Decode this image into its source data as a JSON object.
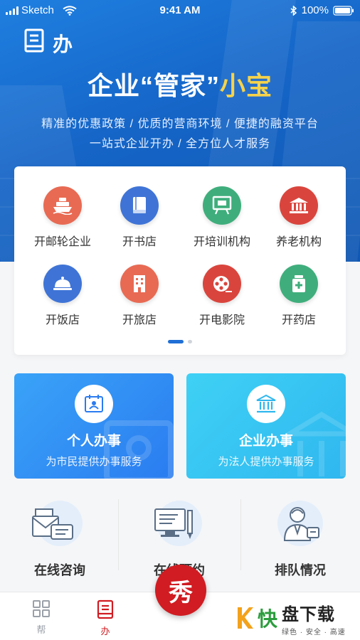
{
  "status_bar": {
    "carrier": "Sketch",
    "time": "9:41 AM",
    "battery": "100%"
  },
  "brand": {
    "title": "办"
  },
  "hero": {
    "headline_main": "企业“管家”",
    "headline_accent": "小宝",
    "subline1": "精准的优惠政策 / 优质的营商环境 / 便捷的融资平台",
    "subline2": "一站式企业开办 / 全方位人才服务"
  },
  "grid": {
    "items": [
      {
        "label": "开邮轮企业",
        "icon": "cruise-ship-icon",
        "color": "#e86a53"
      },
      {
        "label": "开书店",
        "icon": "book-icon",
        "color": "#3f74d6"
      },
      {
        "label": "开培训机构",
        "icon": "easel-icon",
        "color": "#3fae7c"
      },
      {
        "label": "养老机构",
        "icon": "institution-icon",
        "color": "#d9453d"
      },
      {
        "label": "开饭店",
        "icon": "cloche-icon",
        "color": "#3f74d6"
      },
      {
        "label": "开旅店",
        "icon": "hotel-building-icon",
        "color": "#e86a53"
      },
      {
        "label": "开电影院",
        "icon": "film-reel-icon",
        "color": "#d9453d"
      },
      {
        "label": "开药店",
        "icon": "medicine-bottle-icon",
        "color": "#3fae7c"
      }
    ],
    "pager": {
      "active": 1,
      "total": 2
    }
  },
  "services": {
    "personal": {
      "title": "个人办事",
      "subtitle": "为市民提供办事服务"
    },
    "enterprise": {
      "title": "企业办事",
      "subtitle": "为法人提供办事服务"
    }
  },
  "quick": [
    {
      "label": "在线咨询",
      "icon": "chat-mail-icon"
    },
    {
      "label": "在线预约",
      "icon": "computer-pen-icon"
    },
    {
      "label": "排队情况",
      "icon": "queue-person-icon"
    }
  ],
  "tabbar": {
    "tabs": [
      {
        "label": "帮",
        "icon": "grid-icon",
        "active": false
      },
      {
        "label": "办",
        "icon": "document-icon",
        "active": true
      }
    ],
    "center_glyph": "秀"
  },
  "watermark": {
    "logo": "快",
    "title": "盘下载",
    "subtitle": "绿色 · 安全 · 高速"
  },
  "colors": {
    "primary": "#1f7fe0",
    "accent": "#f6d34a",
    "tab_active": "#d01c22"
  }
}
